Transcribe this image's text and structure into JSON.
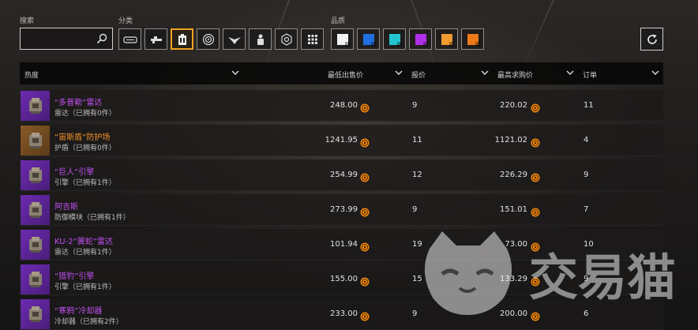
{
  "search": {
    "label": "搜索",
    "placeholder": "",
    "value": ""
  },
  "category": {
    "label": "分类",
    "icons": [
      "radar-category-icon",
      "weapon-category-icon",
      "module-category-icon",
      "engine-category-icon",
      "drone-category-icon",
      "crew-category-icon",
      "shield-category-icon",
      "grid-category-icon"
    ],
    "selected_index": 2
  },
  "quality": {
    "label": "品质",
    "colors": [
      "#f2f2f2",
      "#1f6fe0",
      "#24c4d0",
      "#b030e8",
      "#f09a30",
      "#ef7a1a"
    ]
  },
  "header": {
    "sort_label": "热度",
    "lowest_sell": "最低出售价",
    "bids": "报价",
    "highest_buy": "最高求购价",
    "orders": "订单"
  },
  "rows": [
    {
      "name": "“多普勒”雷达",
      "sub": "雷达（已拥有0件）",
      "quality": "purple",
      "icon": "radar-item-icon",
      "sell": "248.00",
      "bids": "9",
      "buy": "220.02",
      "orders": "11"
    },
    {
      "name": "“宙斯盾”防护场",
      "sub": "护盾（已拥有0件）",
      "quality": "orange",
      "icon": "shield-generator-item-icon",
      "sell": "1241.95",
      "bids": "11",
      "buy": "1121.02",
      "orders": "4"
    },
    {
      "name": "“巨人”引擎",
      "sub": "引擎（已拥有1件）",
      "quality": "purple",
      "icon": "engine-item-icon",
      "sell": "254.99",
      "bids": "12",
      "buy": "226.29",
      "orders": "9"
    },
    {
      "name": "阿吉斯",
      "sub": "防御模块（已拥有1件）",
      "quality": "purple",
      "icon": "defense-module-item-icon",
      "sell": "273.99",
      "bids": "9",
      "buy": "151.01",
      "orders": "7"
    },
    {
      "name": "KU-2“翼蛇”雷达",
      "sub": "雷达（已拥有1件）",
      "quality": "purple",
      "icon": "radar-item-icon",
      "sell": "101.94",
      "bids": "19",
      "buy": "73.00",
      "orders": "10"
    },
    {
      "name": "“猎豹”引擎",
      "sub": "引擎（已拥有1件）",
      "quality": "purple",
      "icon": "engine-item-icon",
      "sell": "155.00",
      "bids": "15",
      "buy": "133.29",
      "orders": "9"
    },
    {
      "name": "“寒鸦”冷却器",
      "sub": "冷却器（已拥有2件）",
      "quality": "purple",
      "icon": "cooler-item-icon",
      "sell": "233.00",
      "bids": "9",
      "buy": "200.00",
      "orders": "6"
    }
  ],
  "watermark": "交易猫"
}
